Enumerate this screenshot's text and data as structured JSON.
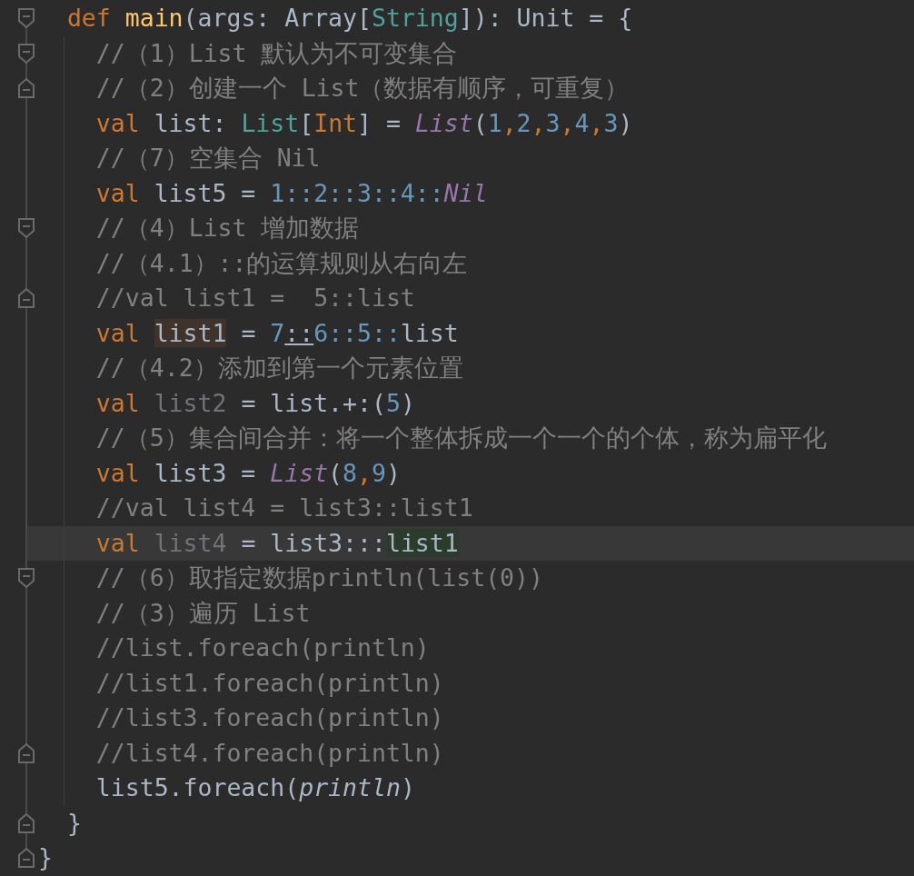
{
  "editor": {
    "lines": [
      {
        "fold": {
          "kind": "start"
        },
        "current": false,
        "tokens": [
          {
            "kind": "kw",
            "text": "  def "
          },
          {
            "kind": "fn",
            "text": "main"
          },
          {
            "kind": "plain",
            "text": "(args: Array["
          },
          {
            "kind": "type",
            "text": "String"
          },
          {
            "kind": "plain",
            "text": "]): Unit = {"
          }
        ]
      },
      {
        "fold": {
          "kind": "start"
        },
        "current": false,
        "tokens": [
          {
            "kind": "comment",
            "text": "    //（1）List 默认为不可变集合"
          }
        ]
      },
      {
        "fold": {
          "kind": "end"
        },
        "current": false,
        "tokens": [
          {
            "kind": "comment",
            "text": "    //（2）创建一个 List（数据有顺序，可重复）"
          }
        ]
      },
      {
        "current": false,
        "tokens": [
          {
            "kind": "kw",
            "text": "    val"
          },
          {
            "kind": "plain",
            "text": " list: "
          },
          {
            "kind": "type",
            "text": "List"
          },
          {
            "kind": "plain",
            "text": "["
          },
          {
            "kind": "kw",
            "text": "Int"
          },
          {
            "kind": "plain",
            "text": "] = "
          },
          {
            "kind": "object",
            "text": "List"
          },
          {
            "kind": "plain",
            "text": "("
          },
          {
            "kind": "num",
            "text": "1"
          },
          {
            "kind": "kw",
            "text": ","
          },
          {
            "kind": "num",
            "text": "2"
          },
          {
            "kind": "kw",
            "text": ","
          },
          {
            "kind": "num",
            "text": "3"
          },
          {
            "kind": "kw",
            "text": ","
          },
          {
            "kind": "num",
            "text": "4"
          },
          {
            "kind": "kw",
            "text": ","
          },
          {
            "kind": "num",
            "text": "3"
          },
          {
            "kind": "plain",
            "text": ")"
          }
        ]
      },
      {
        "current": false,
        "tokens": [
          {
            "kind": "comment",
            "text": "    //（7）空集合 Nil"
          }
        ]
      },
      {
        "current": false,
        "tokens": [
          {
            "kind": "kw",
            "text": "    val"
          },
          {
            "kind": "plain",
            "text": " list5 = "
          },
          {
            "kind": "num",
            "text": "1::2::3::4::"
          },
          {
            "kind": "object",
            "text": "Nil"
          }
        ]
      },
      {
        "fold": {
          "kind": "start"
        },
        "current": false,
        "tokens": [
          {
            "kind": "comment",
            "text": "    //（4）List 增加数据"
          }
        ]
      },
      {
        "current": false,
        "tokens": [
          {
            "kind": "comment",
            "text": "    //（4.1）::的运算规则从右向左"
          }
        ]
      },
      {
        "fold": {
          "kind": "end"
        },
        "current": false,
        "tokens": [
          {
            "kind": "comment",
            "text": "    //val list1 =  5::list"
          }
        ]
      },
      {
        "current": false,
        "tokens": [
          {
            "kind": "kw",
            "text": "    val "
          },
          {
            "kind": "usage",
            "text": "list1"
          },
          {
            "kind": "plain",
            "text": " = "
          },
          {
            "kind": "num",
            "text": "7"
          },
          {
            "kind": "underlined",
            "text": "::"
          },
          {
            "kind": "num",
            "text": "6::5::"
          },
          {
            "kind": "plain",
            "text": "list"
          }
        ]
      },
      {
        "current": false,
        "tokens": [
          {
            "kind": "comment",
            "text": "    //（4.2）添加到第一个元素位置"
          }
        ]
      },
      {
        "current": false,
        "tokens": [
          {
            "kind": "kw",
            "text": "    val"
          },
          {
            "kind": "unused",
            "text": " list2"
          },
          {
            "kind": "plain",
            "text": " = list.+:("
          },
          {
            "kind": "num",
            "text": "5"
          },
          {
            "kind": "plain",
            "text": ")"
          }
        ]
      },
      {
        "current": false,
        "tokens": [
          {
            "kind": "comment",
            "text": "    //（5）集合间合并：将一个整体拆成一个一个的个体，称为扁平化"
          }
        ]
      },
      {
        "current": false,
        "tokens": [
          {
            "kind": "kw",
            "text": "    val"
          },
          {
            "kind": "plain",
            "text": " list3 = "
          },
          {
            "kind": "object",
            "text": "List"
          },
          {
            "kind": "plain",
            "text": "("
          },
          {
            "kind": "num",
            "text": "8"
          },
          {
            "kind": "kw",
            "text": ","
          },
          {
            "kind": "num",
            "text": "9"
          },
          {
            "kind": "plain",
            "text": ")"
          }
        ]
      },
      {
        "current": false,
        "tokens": [
          {
            "kind": "comment",
            "text": "    //val list4 = list3::list1"
          }
        ]
      },
      {
        "current": true,
        "tokens": [
          {
            "kind": "kw",
            "text": "    val"
          },
          {
            "kind": "unused",
            "text": " list4"
          },
          {
            "kind": "plain",
            "text": " = list3:::"
          },
          {
            "kind": "match",
            "text": "list1"
          }
        ]
      },
      {
        "fold": {
          "kind": "start"
        },
        "current": false,
        "tokens": [
          {
            "kind": "comment",
            "text": "    //（6）取指定数据println(list(0))"
          }
        ]
      },
      {
        "current": false,
        "tokens": [
          {
            "kind": "comment",
            "text": "    //（3）遍历 List"
          }
        ]
      },
      {
        "current": false,
        "tokens": [
          {
            "kind": "comment",
            "text": "    //list.foreach(println)"
          }
        ]
      },
      {
        "current": false,
        "tokens": [
          {
            "kind": "comment",
            "text": "    //list1.foreach(println)"
          }
        ]
      },
      {
        "current": false,
        "tokens": [
          {
            "kind": "comment",
            "text": "    //list3.foreach(println)"
          }
        ]
      },
      {
        "fold": {
          "kind": "end"
        },
        "current": false,
        "tokens": [
          {
            "kind": "comment",
            "text": "    //list4.foreach(println)"
          }
        ]
      },
      {
        "current": false,
        "tokens": [
          {
            "kind": "plain",
            "text": "    list5.foreach("
          },
          {
            "kind": "italic",
            "text": "println"
          },
          {
            "kind": "plain",
            "text": ")"
          }
        ]
      },
      {
        "fold": {
          "kind": "end"
        },
        "current": false,
        "tokens": [
          {
            "kind": "plain",
            "text": "  }"
          }
        ]
      },
      {
        "fold": {
          "kind": "end"
        },
        "current": false,
        "tokens": [
          {
            "kind": "plain",
            "text": "}"
          }
        ]
      }
    ]
  }
}
